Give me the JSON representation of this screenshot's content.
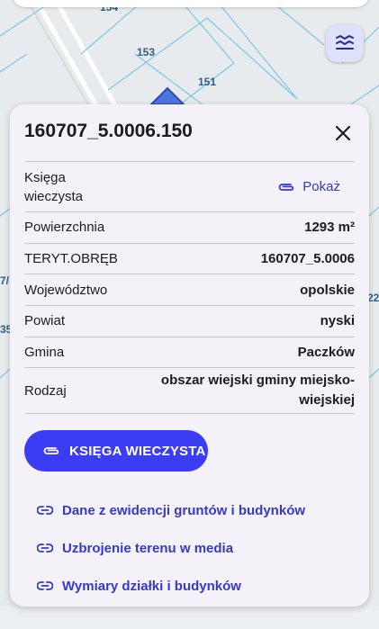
{
  "map": {
    "labels": [
      "154",
      "153",
      "151",
      "7/",
      "35",
      "22"
    ]
  },
  "colors": {
    "accent": "#3b3df5",
    "link": "#3539c6",
    "panel_bg": "#f4f2f8",
    "parcel_line": "#7ec6e4"
  },
  "icons": {
    "layers": "layers-icon",
    "close": "close-icon",
    "attachment": "paperclip-icon",
    "link": "link-icon"
  },
  "parcel": {
    "id": "160707_5.0006.150",
    "rows": {
      "ksiega": {
        "label": "Księga wieczysta",
        "action": "Pokaż"
      },
      "powierzchnia": {
        "label": "Powierzchnia",
        "value": "1293 m²"
      },
      "teryt": {
        "label": "TERYT.OBRĘB",
        "value": "160707_5.0006"
      },
      "wojewodztwo": {
        "label": "Województwo",
        "value": "opolskie"
      },
      "powiat": {
        "label": "Powiat",
        "value": "nyski"
      },
      "gmina": {
        "label": "Gmina",
        "value": "Paczków"
      },
      "rodzaj": {
        "label": "Rodzaj",
        "value": "obszar wiejski gminy miejsko-wiejskiej"
      }
    }
  },
  "actions": {
    "kw_button": "KSIĘGA WIECZYSTA",
    "links": [
      "Dane z ewidencji gruntów i budynków",
      "Uzbrojenie terenu w media",
      "Wymiary działki i budynków"
    ]
  }
}
